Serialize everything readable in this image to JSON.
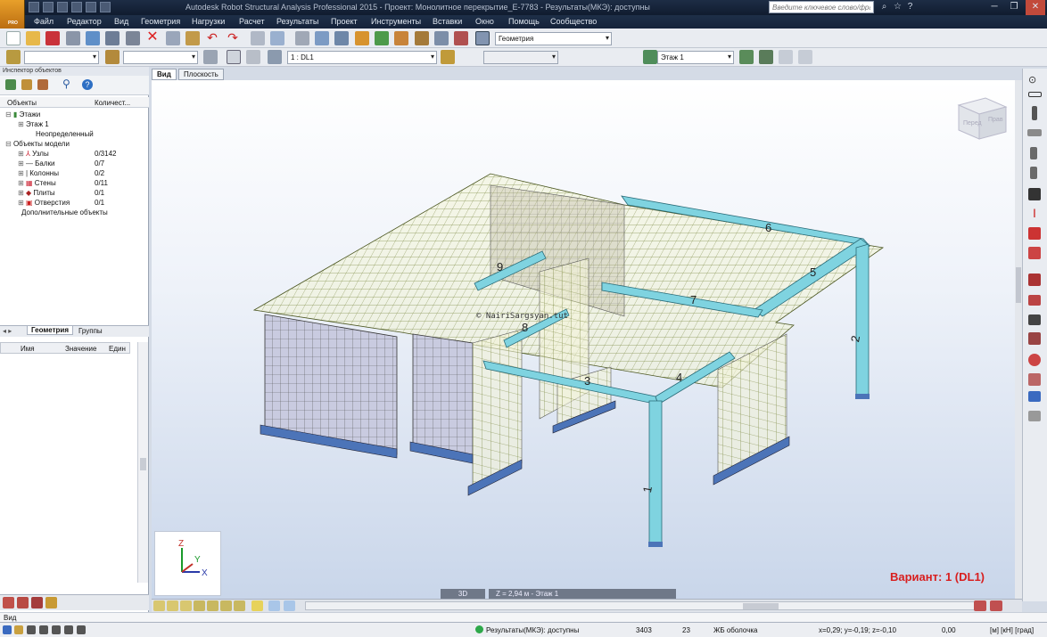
{
  "window": {
    "title": "Autodesk Robot Structural Analysis Professional 2015 - Проект: Монолитное перекрытие_E-7783 - Результаты(МКЭ): доступны",
    "search_placeholder": "Введите ключевое слово/фразу",
    "logo_text": "PRO"
  },
  "menu": [
    "Файл",
    "Редактор",
    "Вид",
    "Геометрия",
    "Нагрузки",
    "Расчет",
    "Результаты",
    "Проект",
    "Инструменты",
    "Вставки",
    "Окно",
    "Помощь",
    "Сообщество"
  ],
  "toolbar": {
    "geometry_combo": "Геометрия",
    "case_combo": "1 : DL1",
    "storey_combo": "Этаж 1"
  },
  "inspector": {
    "title": "Инспектор объектов",
    "col_objects": "Объекты",
    "col_count": "Количест...",
    "tree": [
      {
        "label": "Этажи",
        "count": "",
        "indent": 0,
        "icon": "storeys-icon"
      },
      {
        "label": "Этаж 1",
        "count": "",
        "indent": 1,
        "icon": ""
      },
      {
        "label": "Неопределенный",
        "count": "",
        "indent": 1,
        "icon": ""
      },
      {
        "label": "Объекты модели",
        "count": "",
        "indent": 0,
        "icon": ""
      },
      {
        "label": "Узлы",
        "count": "0/3142",
        "indent": 1,
        "icon": "node-icon"
      },
      {
        "label": "Балки",
        "count": "0/7",
        "indent": 1,
        "icon": "beam-icon"
      },
      {
        "label": "Колонны",
        "count": "0/2",
        "indent": 1,
        "icon": "column-icon"
      },
      {
        "label": "Стены",
        "count": "0/11",
        "indent": 1,
        "icon": "wall-icon"
      },
      {
        "label": "Плиты",
        "count": "0/1",
        "indent": 1,
        "icon": "slab-icon"
      },
      {
        "label": "Отверстия",
        "count": "0/1",
        "indent": 1,
        "icon": "opening-icon"
      },
      {
        "label": "Дополнительные объекты",
        "count": "",
        "indent": 0,
        "icon": ""
      }
    ],
    "tab_geometry": "Геометрия",
    "tab_groups": "Группы",
    "grid_name": "Имя",
    "grid_value": "Значение",
    "grid_unit": "Един"
  },
  "view": {
    "tab_view": "Вид",
    "tab_plane": "Плоскость",
    "nav_3d": "3D",
    "nav_level": "Z = 2,94 м - Этаж 1",
    "variant": "Вариант: 1 (DL1)",
    "watermark": "© NairiSargsyan.tut",
    "cube_front": "Перед",
    "cube_right": "Прав",
    "member_labels": [
      "1",
      "2",
      "3",
      "4",
      "5",
      "6",
      "7",
      "8",
      "9"
    ],
    "axis_z": "Z",
    "axis_y": "Y",
    "axis_x": "X"
  },
  "status": {
    "view_label": "Вид",
    "results": "Результаты(МКЭ): доступны",
    "count1": "3403",
    "count2": "23",
    "section": "ЖБ оболочка",
    "coords": "x=0,29; y=-0,19; z=-0,10",
    "value": "0,00",
    "units": "[м] [кН] [град]"
  },
  "colors": {
    "accent_title": "#1d2d45",
    "mesh": "#6b7a2a",
    "beam": "#7fd3e0",
    "variant": "#d81e1e"
  }
}
